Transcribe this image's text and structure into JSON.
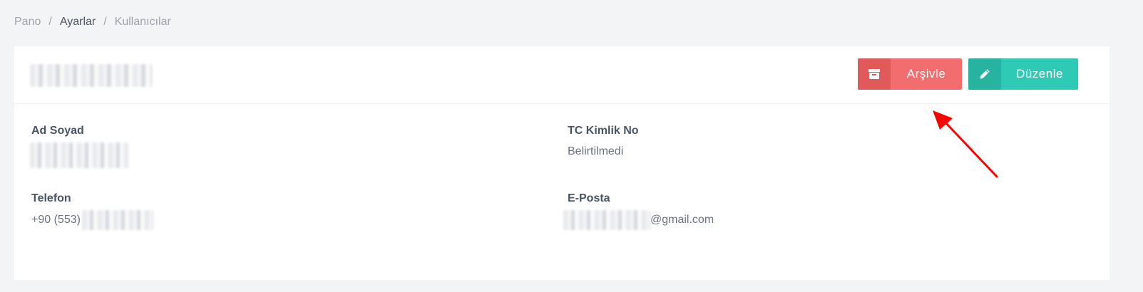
{
  "breadcrumb": {
    "items": [
      "Pano",
      "Ayarlar",
      "Kullanıcılar"
    ],
    "separator": "/"
  },
  "header": {
    "archive_label": "Arşivle",
    "edit_label": "Düzenle"
  },
  "details": {
    "name_label": "Ad Soyad",
    "tc_label": "TC Kimlik No",
    "tc_value": "Belirtilmedi",
    "phone_label": "Telefon",
    "phone_prefix": "+90 (553)",
    "email_label": "E-Posta",
    "email_suffix": "@gmail.com"
  },
  "colors": {
    "archive": "#f26d6d",
    "edit": "#2fcab5",
    "annotation": "#ff0000"
  },
  "icons": {
    "archive": "archive-box-icon",
    "edit": "pencil-icon"
  }
}
